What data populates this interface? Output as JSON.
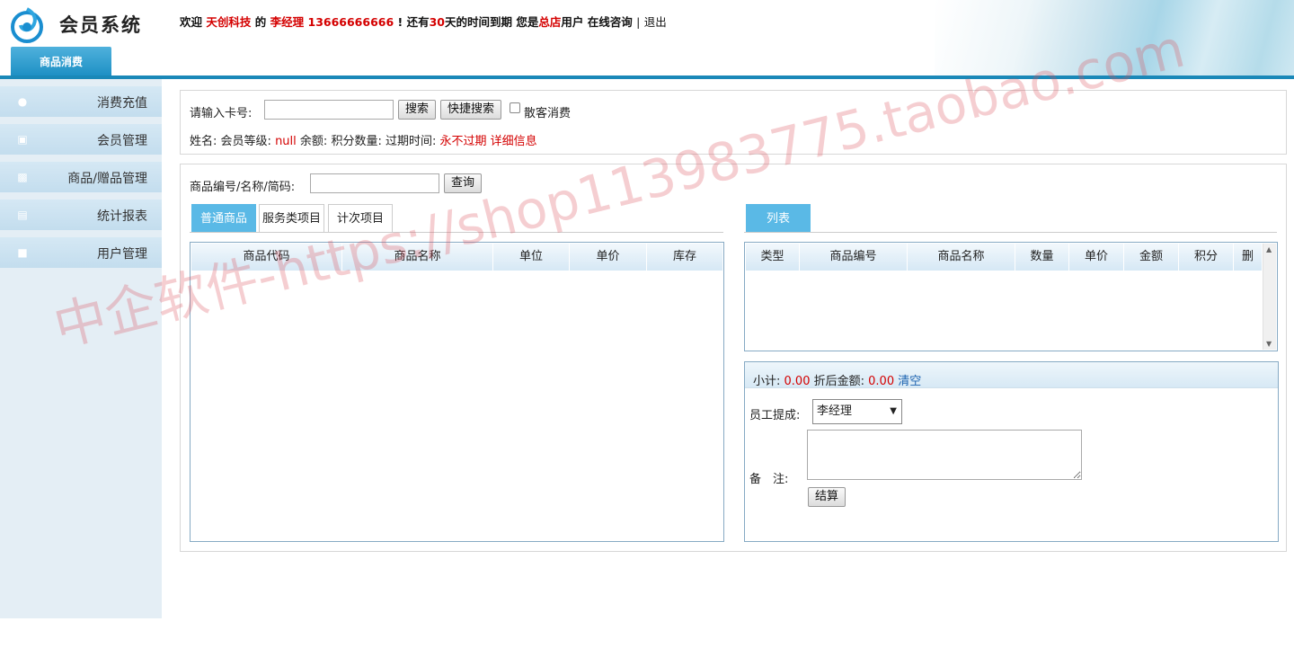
{
  "header": {
    "app_title": "会员系统",
    "welcome_prefix": "欢迎",
    "company": "天创科技",
    "of": "的",
    "manager": "李经理",
    "phone": "13666666666",
    "expire_prefix": "! 还有",
    "days": "30",
    "expire_suffix": "天的时间到期 您是",
    "role": "总店",
    "role_suffix": "用户",
    "consult_link": "在线咨询",
    "separator": "|",
    "logout_link": "退出",
    "main_tab": "商品消费"
  },
  "sidebar": {
    "items": [
      {
        "label": "消费充值",
        "icon": "user-icon"
      },
      {
        "label": "会员管理",
        "icon": "card-icon"
      },
      {
        "label": "商品/赠品管理",
        "icon": "gift-icon"
      },
      {
        "label": "统计报表",
        "icon": "monitor-icon"
      },
      {
        "label": "用户管理",
        "icon": "lock-icon"
      }
    ]
  },
  "search_panel": {
    "card_label": "请输入卡号:",
    "card_value": "",
    "search_button": "搜索",
    "quick_search_button": "快捷搜索",
    "guest_checkbox_label": "散客消费",
    "guest_checked": false,
    "info_name_label": "姓名:",
    "info_level_label": "会员等级:",
    "info_level_value": "null",
    "info_balance_label": "余额:",
    "info_points_label": "积分数量:",
    "info_expire_label": "过期时间:",
    "info_expire_value": "永不过期",
    "detail_link": "详细信息"
  },
  "product_panel": {
    "query_label": "商品编号/名称/简码:",
    "query_value": "",
    "query_button": "查询",
    "tabs": [
      "普通商品",
      "服务类项目",
      "计次项目"
    ],
    "active_tab": 0,
    "columns": [
      "商品代码",
      "商品名称",
      "单位",
      "单价",
      "库存"
    ]
  },
  "cart_panel": {
    "tab": "列表",
    "columns": [
      "类型",
      "商品编号",
      "商品名称",
      "数量",
      "单价",
      "金额",
      "积分",
      "删"
    ],
    "subtotal_label": "小计:",
    "subtotal_value": "0.00",
    "discount_label": "折后金额:",
    "discount_value": "0.00",
    "clear_link": "清空",
    "staff_label": "员工提成:",
    "staff_selected": "李经理",
    "note_label": "备　注:",
    "note_value": "",
    "checkout_button": "结算"
  },
  "watermark": "中企软件-https://shop113983775.taobao.com",
  "colors": {
    "accent": "#1a88b8",
    "tab_active": "#5ab9e6",
    "highlight_red": "#d40000",
    "link_blue": "#1d63b0"
  }
}
